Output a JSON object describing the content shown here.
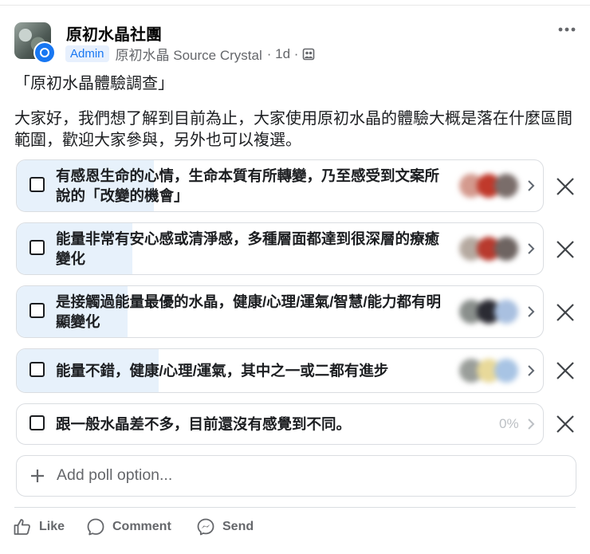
{
  "post": {
    "group_name": "原初水晶社團",
    "admin_badge": "Admin",
    "author": "原初水晶 Source Crystal",
    "time": "· 1d ·",
    "title": "「原初水晶體驗調查」",
    "body": "大家好，我們想了解到目前為止，大家使用原初水晶的體驗大概是落在什麼區間範圍，歡迎大家參與，另外也可以複選。"
  },
  "poll": {
    "options": [
      {
        "text": "有感恩生命的心情，生命本質有所轉變，乃至感受到文案所說的「改變的機會」",
        "fill": 0.26
      },
      {
        "text": "能量非常有安心感或清淨感，多種層面都達到很深層的療癒變化",
        "fill": 0.22
      },
      {
        "text": "是接觸過能量最優的水晶，健康/心理/運氣/智慧/能力都有明顯變化",
        "fill": 0.21
      },
      {
        "text": "能量不錯，健康/心理/運氣，其中之一或二都有進步",
        "fill": 0.27
      },
      {
        "text": "跟一般水晶差不多，目前還沒有感覺到不同。",
        "fill": 0,
        "percent": "0%"
      }
    ],
    "add_option_label": "Add poll option..."
  },
  "actions": {
    "like": "Like",
    "comment": "Comment",
    "send": "Send"
  },
  "colors": {
    "accent": "#1877f2",
    "poll_fill": "#e7f1fb",
    "muted_text": "#65676b"
  }
}
